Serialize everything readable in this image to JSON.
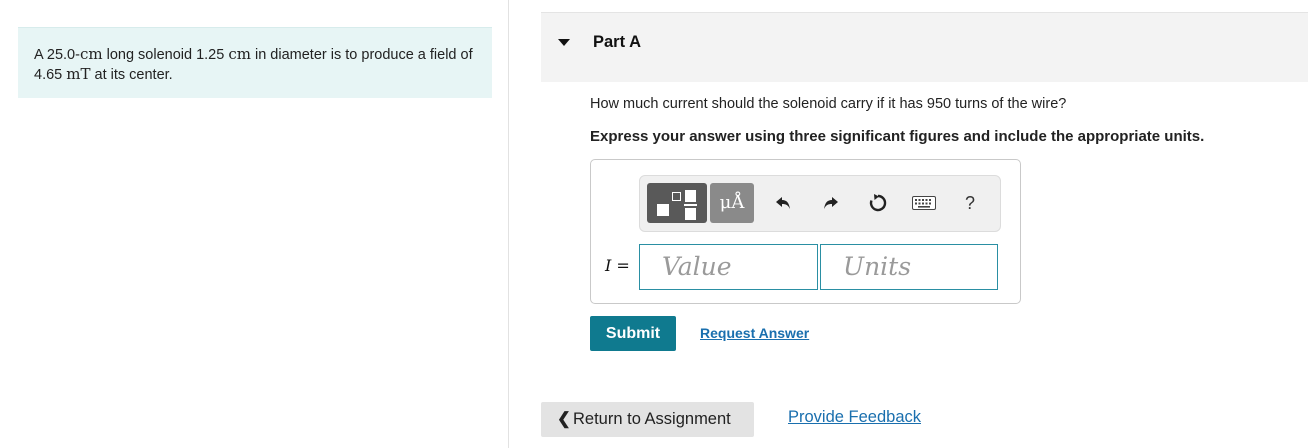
{
  "problem": {
    "text_1": "A 25.0-",
    "unit_1": "cm",
    "text_2": " long solenoid 1.25 ",
    "unit_2": "cm",
    "text_3": " in diameter is to produce a field of 4.65 ",
    "unit_3": "mT",
    "text_4": " at its center."
  },
  "part": {
    "title": "Part A",
    "question": "How much current should the solenoid carry if it has 950 turns of the wire?",
    "instruction": "Express your answer using three significant figures and include the appropriate units."
  },
  "toolbar": {
    "units_button": "μÅ",
    "help_button": "?",
    "icons": [
      "templates-icon",
      "undo-icon",
      "redo-icon",
      "reset-icon",
      "keyboard-icon",
      "help-icon"
    ]
  },
  "answer": {
    "variable": "I",
    "equals": " =",
    "value_placeholder": "Value",
    "units_placeholder": "Units"
  },
  "actions": {
    "submit_label": "Submit",
    "request_answer_label": "Request Answer"
  },
  "footer": {
    "return_label": "Return to Assignment",
    "feedback_label": "Provide Feedback"
  },
  "colors": {
    "accent": "#0f7a8f",
    "link": "#1a6fae",
    "problem_bg": "#e7f5f5",
    "field_border": "#2a8fa3"
  }
}
